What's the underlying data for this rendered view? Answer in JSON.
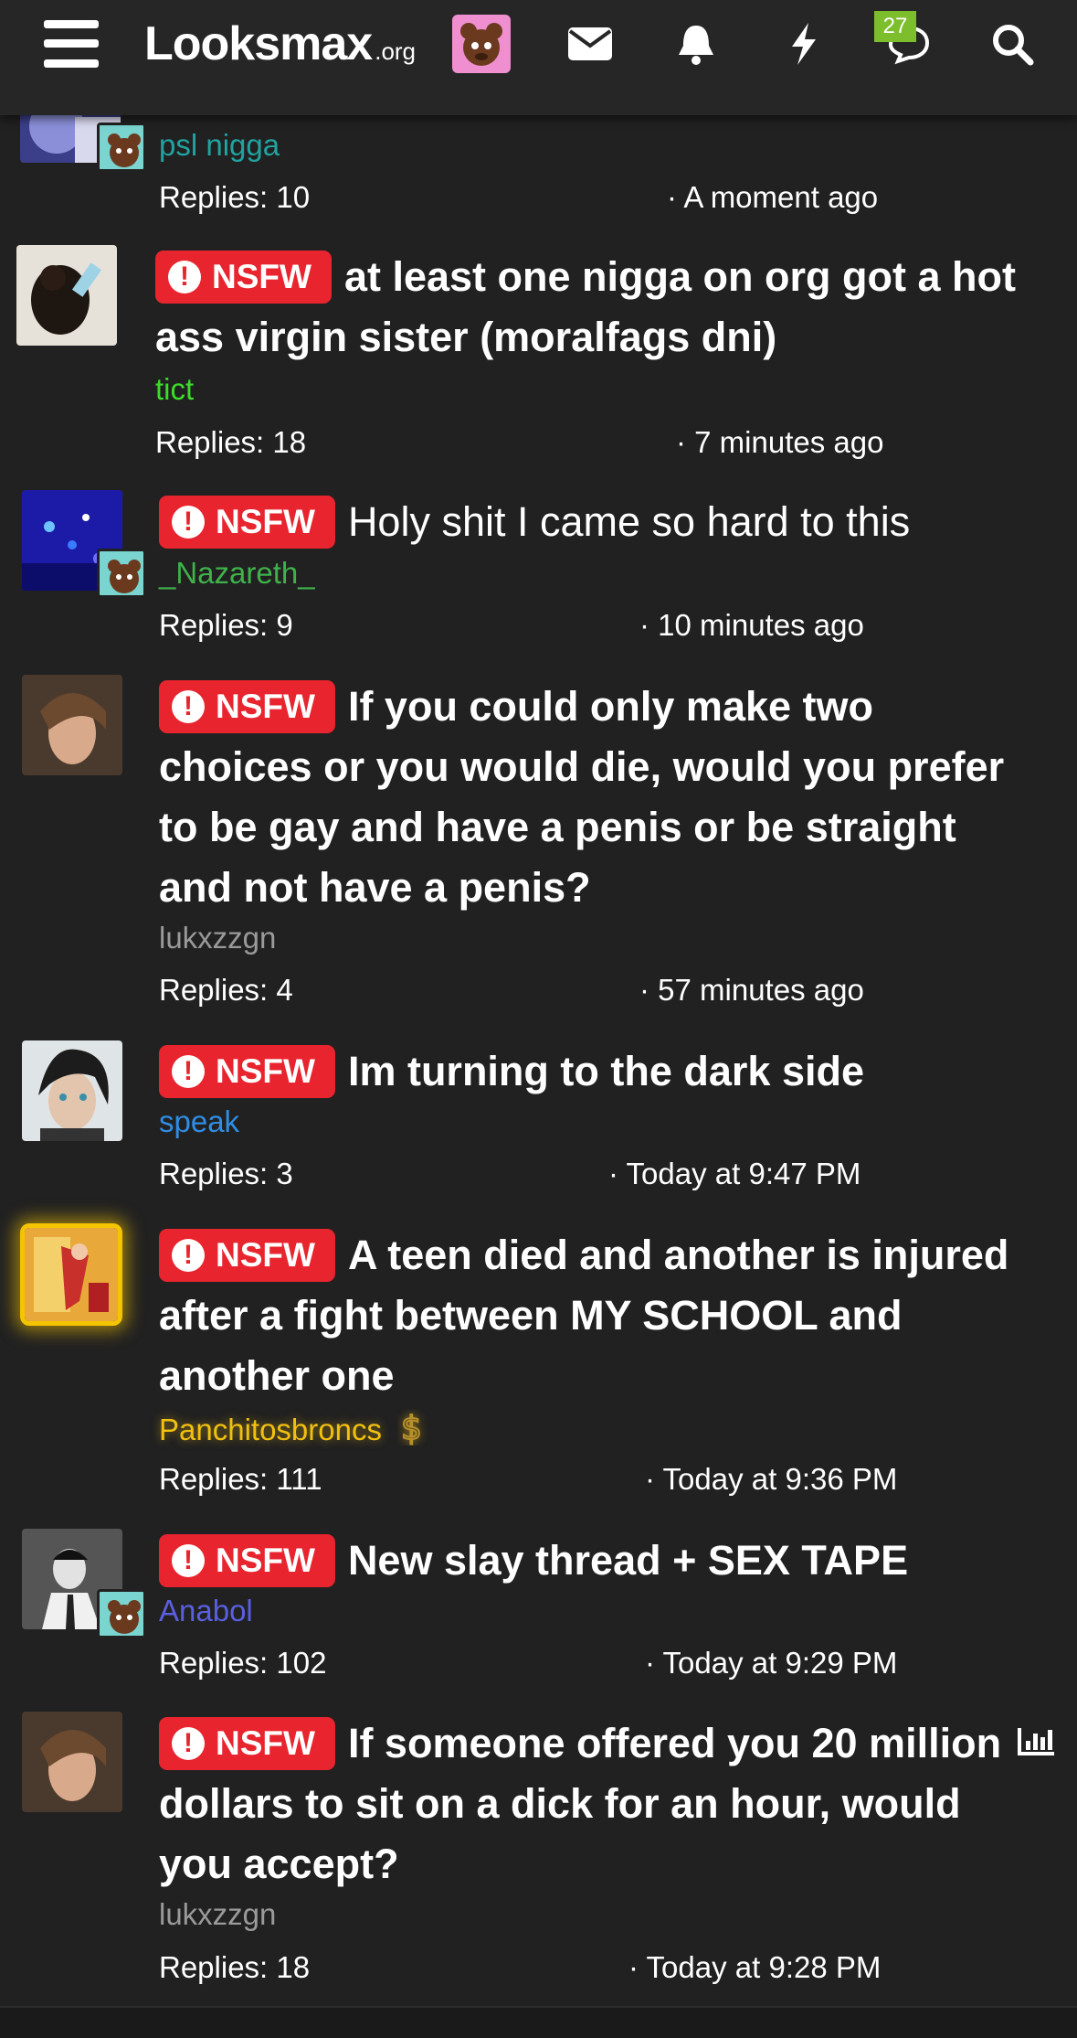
{
  "header": {
    "logo_main": "Looksmax",
    "logo_sub": ".org",
    "chat_badge_count": "27",
    "icons": [
      "menu-icon",
      "user-avatar",
      "envelope-icon",
      "bell-icon",
      "lightning-icon",
      "chat-icon",
      "search-icon"
    ]
  },
  "threads": [
    {
      "title": "",
      "author": "psl nigga",
      "author_color": "#21a3a0",
      "replies": "Replies: 10",
      "time": "· A moment ago"
    },
    {
      "badge": "NSFW",
      "title": "at least one nigga on org got a hot ass virgin sister (moralfags dni)",
      "author": "tict",
      "author_color": "#3ddc2b",
      "replies": "Replies: 18",
      "time": "· 7 minutes ago"
    },
    {
      "badge": "NSFW",
      "title": "Holy shit I came so hard to this",
      "author": "_Nazareth_",
      "author_color": "#3fb24a",
      "replies": "Replies: 9",
      "time": "· 10 minutes ago"
    },
    {
      "badge": "NSFW",
      "title": "If you could only make two choices or you would die, would you prefer to be gay and have a penis or be straight and not have a penis?",
      "author": "lukxzzgn",
      "author_color": "#9a9a9a",
      "replies": "Replies: 4",
      "time": "· 57 minutes ago"
    },
    {
      "badge": "NSFW",
      "title": "Im turning to the dark side",
      "author": "speak",
      "author_color": "#2f8de4",
      "replies": "Replies: 3",
      "time": "· Today at 9:47 PM"
    },
    {
      "badge": "NSFW",
      "title": "A teen died and another is injured after a fight between MY SCHOOL and another one",
      "author": "Panchitosbroncs",
      "author_color": "#f2c00f",
      "replies": "Replies: 111",
      "time": "· Today at 9:36 PM"
    },
    {
      "badge": "NSFW",
      "title": "New slay thread + SEX TAPE",
      "author": "Anabol",
      "author_color": "#5a5fe0",
      "replies": "Replies: 102",
      "time": "· Today at 9:29 PM"
    },
    {
      "badge": "NSFW",
      "title": "If someone offered you 20 million dollars to sit on a dick for an hour, would you accept?",
      "author": "lukxzzgn",
      "author_color": "#9a9a9a",
      "replies": "Replies: 18",
      "time": "· Today at 9:28 PM"
    }
  ]
}
